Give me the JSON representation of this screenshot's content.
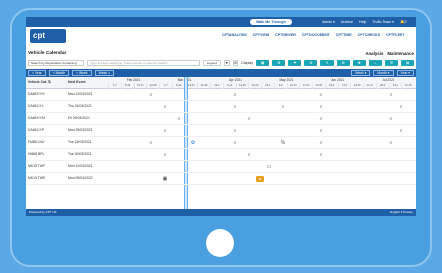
{
  "header": {
    "walk_me": "Walk Me Through",
    "menu": [
      "Admin ▾",
      "Archive",
      "Help",
      "Truflo Team ▾",
      "🔔0"
    ]
  },
  "logo_text": "cpt",
  "nav_tabs": [
    "CPTANALYSIS",
    "CPTVIEW",
    "CPTDRIVER",
    "CPTDOCUMENT",
    "CPTTIME",
    "CPTCHECKS",
    "CPTFLEET"
  ],
  "page": {
    "title": "Vehicle Calendar",
    "modes": [
      "Analysis",
      "Maintenance"
    ]
  },
  "filters": {
    "select_value": "Search by Registration Containing",
    "search_placeholder": "Type to begin searching. Press escape to clear the search",
    "legend_label": "Legend",
    "display_label": "Display"
  },
  "navbar": {
    "left": [
      "< Year",
      "< Month",
      "< Week",
      "Week >"
    ],
    "right": [
      "Week ▾",
      "Month ▾",
      "Year ▾"
    ]
  },
  "grid": {
    "col_vehicle": "Vehicle Cat. ⇅",
    "col_next": "Next Event",
    "months": [
      "Feb 2021",
      "Mar 2021",
      "Apr 2021",
      "May 2021",
      "Jun 2021",
      "Jul 2021"
    ],
    "days": [
      "1-7",
      "8-14",
      "15-21",
      "22-28",
      "1-7",
      "8-14",
      "15-21",
      "22-28",
      "29-4",
      "5-11",
      "12-18",
      "19-25",
      "26-2",
      "3-9",
      "10-16",
      "17-23",
      "24-30",
      "31-6",
      "7-13",
      "14-20",
      "21-27",
      "28-4",
      "5-11",
      "12-18"
    ],
    "rows": [
      {
        "vehicle": "DA68 KYH",
        "date": "Mon 22/03/2021"
      },
      {
        "vehicle": "DA68 KYL",
        "date": "Thu 01/04/2021"
      },
      {
        "vehicle": "DA68 KYM",
        "date": "Fri 09/04/2021"
      },
      {
        "vehicle": "DA68 KYP",
        "date": "Mon 29/03/2021"
      },
      {
        "vehicle": "FM68 LNU",
        "date": "Tue 23/03/2021"
      },
      {
        "vehicle": "HM68 BPL",
        "date": "Tue 30/03/2021"
      },
      {
        "vehicle": "MK19 TWF",
        "date": "Mon 12/04/2021"
      },
      {
        "vehicle": "MK19 TWE",
        "date": "Mon 05/04/2022"
      }
    ]
  },
  "footer": {
    "left": "Powered by CPT UK",
    "right": "English ▾  Privacy"
  }
}
